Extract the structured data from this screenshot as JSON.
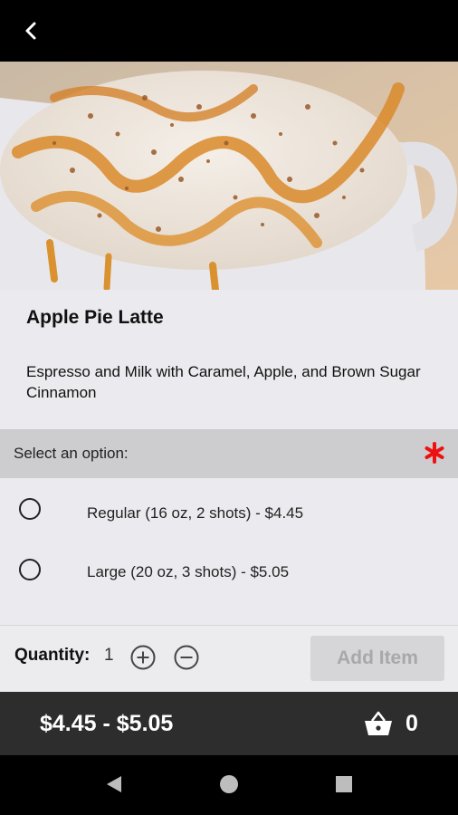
{
  "header": {
    "back_icon": "chevron-left-icon"
  },
  "item": {
    "title": "Apple Pie Latte",
    "description": "Espresso and Milk with Caramel, Apple, and Brown Sugar Cinnamon"
  },
  "options": {
    "header_label": "Select an option:",
    "required_icon": "asterisk-icon",
    "required_color": "#ee1111",
    "items": [
      {
        "label": "Regular (16 oz, 2 shots) - $4.45",
        "selected": false
      },
      {
        "label": "Large (20 oz, 3 shots) - $5.05",
        "selected": false
      }
    ]
  },
  "quantity": {
    "label": "Quantity:",
    "value": "1"
  },
  "add_button": {
    "label": "Add Item",
    "enabled": false
  },
  "footer": {
    "price_range": "$4.45 - $5.05",
    "cart_count": "0",
    "cart_icon": "basket-icon"
  },
  "navbar": {
    "icons": [
      "back-triangle-icon",
      "home-circle-icon",
      "recents-square-icon"
    ]
  }
}
